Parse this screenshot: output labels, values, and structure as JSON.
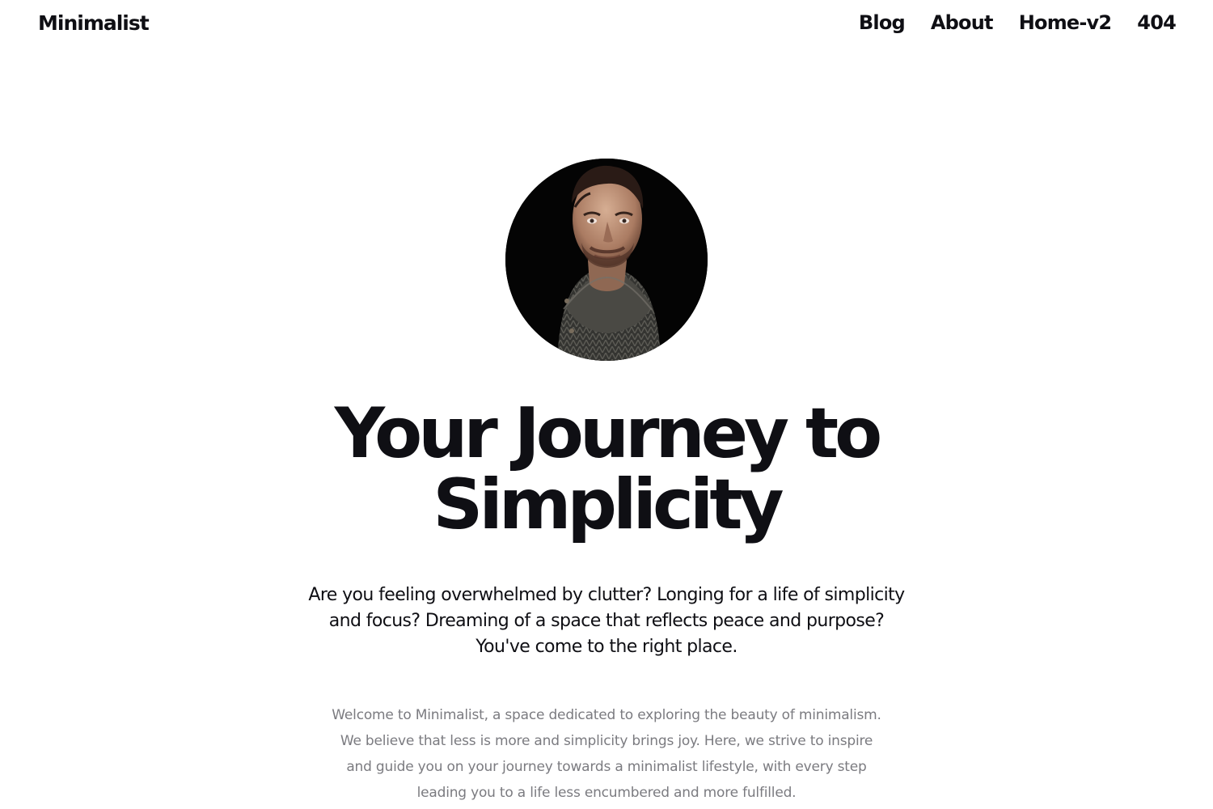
{
  "header": {
    "brand": "Minimalist",
    "nav": [
      {
        "label": "Blog"
      },
      {
        "label": "About"
      },
      {
        "label": "Home-v2"
      },
      {
        "label": "404"
      }
    ]
  },
  "hero": {
    "avatar_alt": "portrait-photo",
    "title_line1": "Your Journey to",
    "title_line2": "Simplicity",
    "lead": "Are you feeling overwhelmed by clutter? Longing for a life of simplicity and focus? Dreaming of a space that reflects peace and purpose? You've come to the right place.",
    "body": "Welcome to Minimalist, a space dedicated to exploring the beauty of minimalism. We believe that less is more and simplicity brings joy. Here, we strive to inspire and guide you on your journey towards a minimalist lifestyle, with every step leading you to a life less encumbered and more fulfilled."
  },
  "colors": {
    "text": "#0f0f14",
    "muted": "#7b7b80",
    "background": "#ffffff"
  }
}
